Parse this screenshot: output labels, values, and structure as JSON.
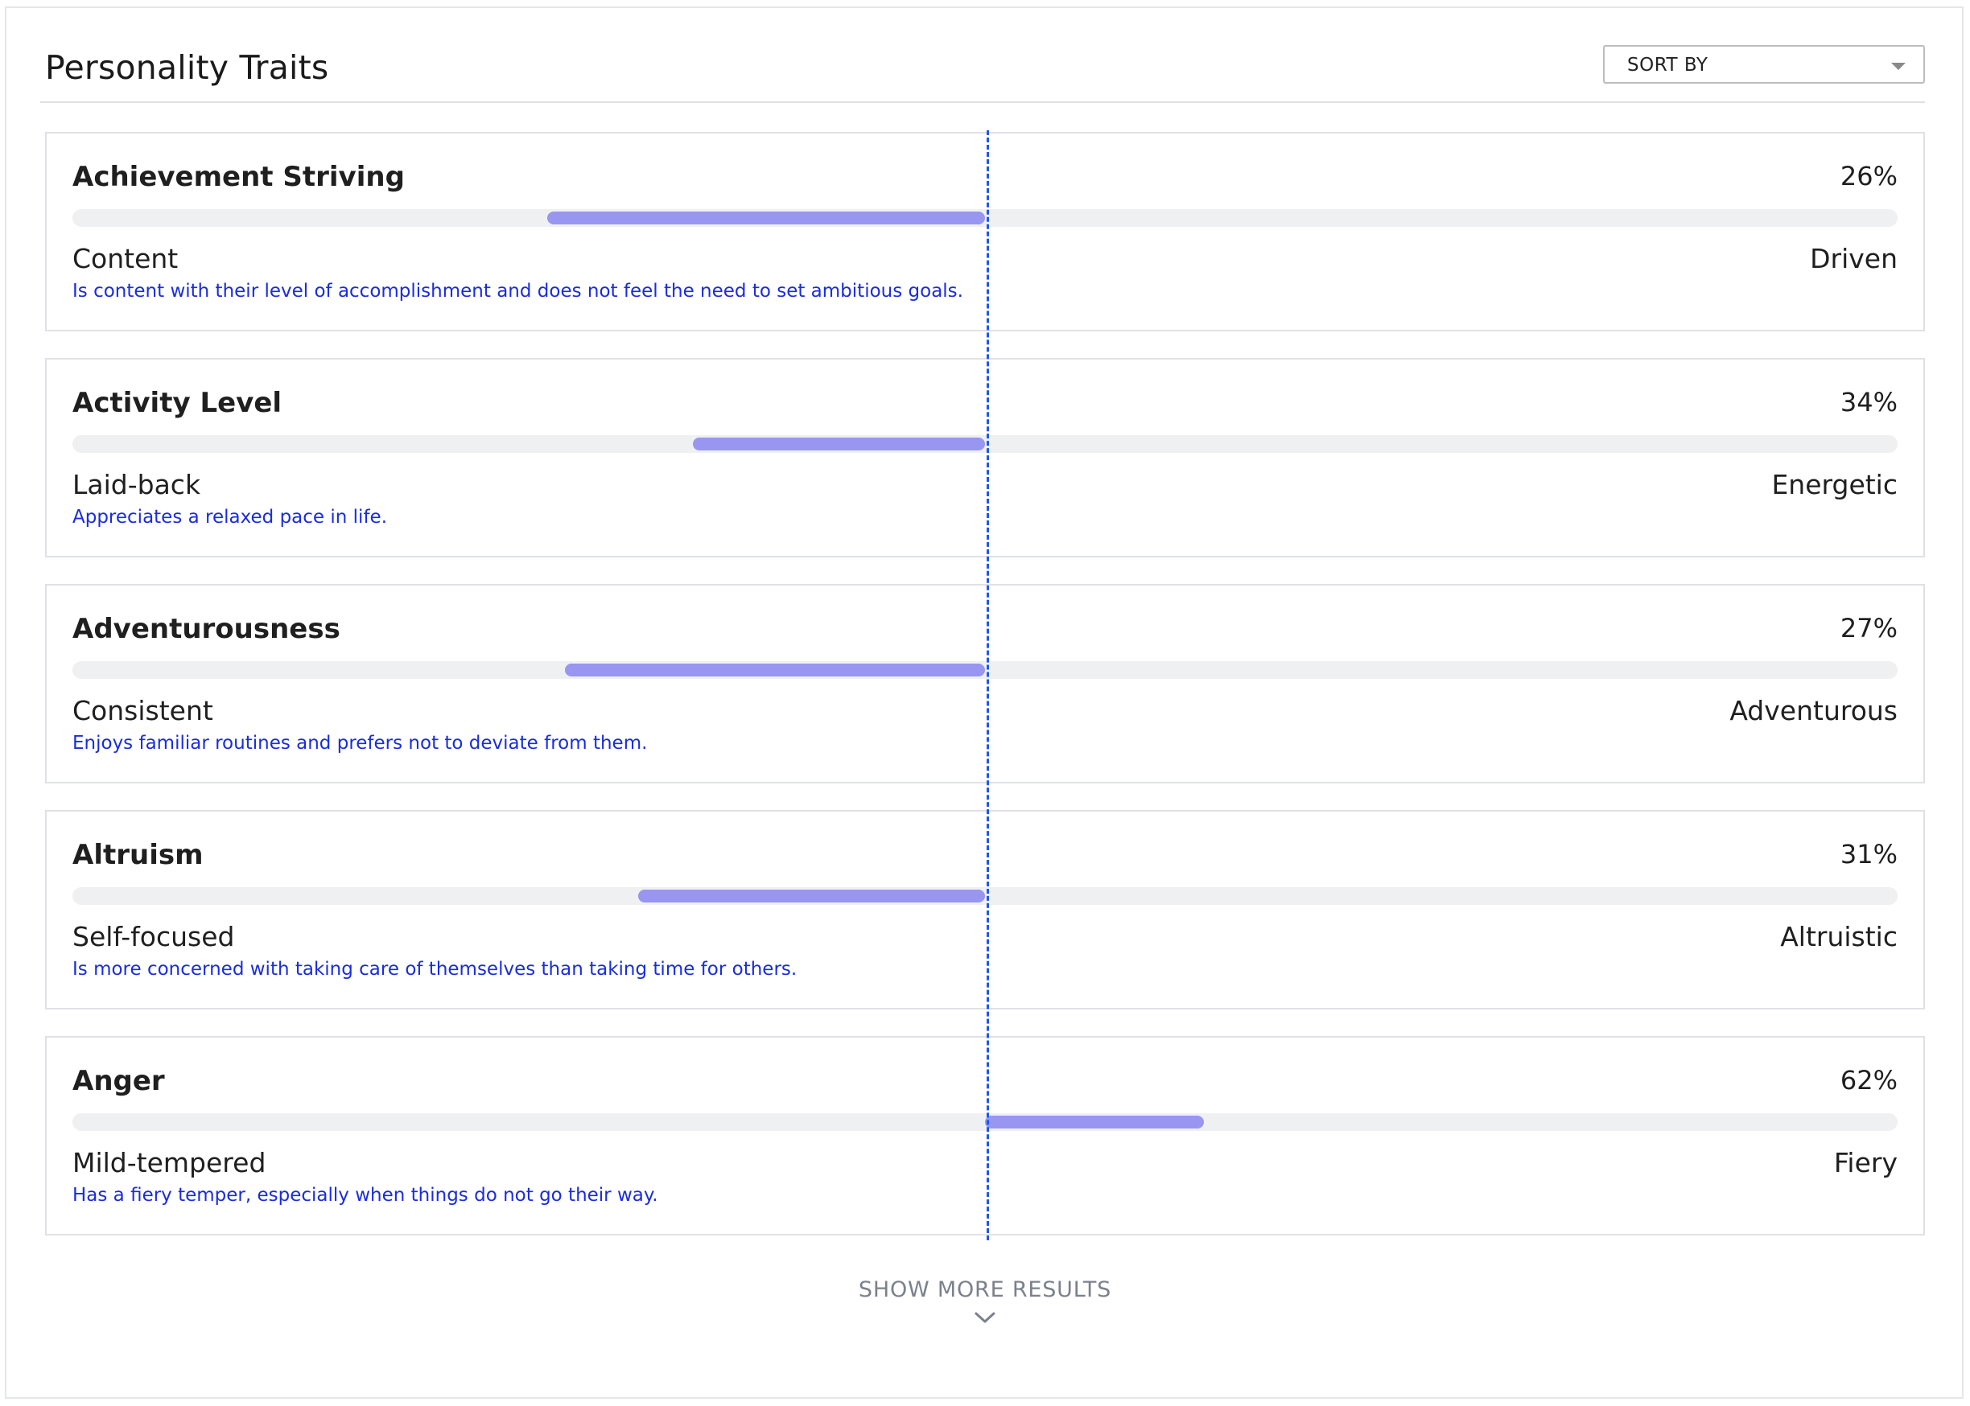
{
  "header": {
    "title": "Personality Traits",
    "sort_label": "SORT BY"
  },
  "colors": {
    "bar_fill": "#9896f0",
    "bar_track": "#eff0f2",
    "description_text": "#1a2ce0",
    "midline": "#1e56f5"
  },
  "traits": [
    {
      "name": "Achievement Striving",
      "percent_label": "26%",
      "percentile": 26,
      "low_label": "Content",
      "high_label": "Driven",
      "description": "Is content with their level of accomplishment and does not feel the need to set ambitious goals."
    },
    {
      "name": "Activity Level",
      "percent_label": "34%",
      "percentile": 34,
      "low_label": "Laid-back",
      "high_label": "Energetic",
      "description": "Appreciates a relaxed pace in life."
    },
    {
      "name": "Adventurousness",
      "percent_label": "27%",
      "percentile": 27,
      "low_label": "Consistent",
      "high_label": "Adventurous",
      "description": "Enjoys familiar routines and prefers not to deviate from them."
    },
    {
      "name": "Altruism",
      "percent_label": "31%",
      "percentile": 31,
      "low_label": "Self-focused",
      "high_label": "Altruistic",
      "description": "Is more concerned with taking care of themselves than taking time for others."
    },
    {
      "name": "Anger",
      "percent_label": "62%",
      "percentile": 62,
      "low_label": "Mild-tempered",
      "high_label": "Fiery",
      "description": "Has a fiery temper, especially when things do not go their way."
    }
  ],
  "footer": {
    "show_more_label": "SHOW MORE RESULTS",
    "show_more_icon": "chevron-down-icon"
  }
}
